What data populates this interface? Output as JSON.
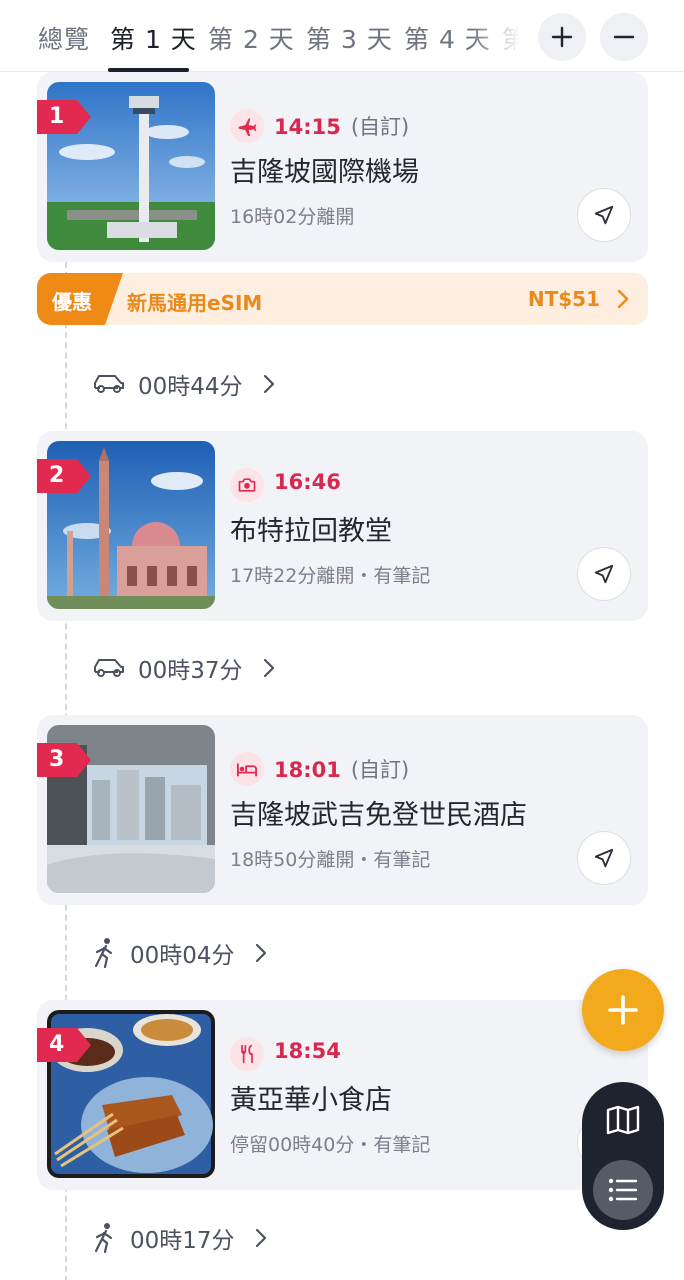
{
  "tabs": {
    "items": [
      {
        "label": "總覽",
        "active": false
      },
      {
        "label": "第 1 天",
        "active": true
      },
      {
        "label": "第 2 天",
        "active": false
      },
      {
        "label": "第 3 天",
        "active": false
      },
      {
        "label": "第 4 天",
        "active": false
      },
      {
        "label": "第",
        "active": false
      }
    ],
    "add_icon": "plus-icon",
    "remove_icon": "minus-icon"
  },
  "colors": {
    "accent_red": "#d8284f",
    "promo_orange": "#ef8a17",
    "fab_yellow": "#f2a91c",
    "dark_panel": "#1f2330"
  },
  "stops": [
    {
      "number": "1",
      "icon": "airplane-icon",
      "time": "14:15",
      "note": "(自訂)",
      "name": "吉隆坡國際機場",
      "sub": "16時02分離開"
    },
    {
      "number": "2",
      "icon": "camera-icon",
      "time": "16:46",
      "note": "",
      "name": "布特拉回教堂",
      "sub": "17時22分離開・有筆記"
    },
    {
      "number": "3",
      "icon": "bed-icon",
      "time": "18:01",
      "note": "(自訂)",
      "name": "吉隆坡武吉免登世民酒店",
      "sub": "18時50分離開・有筆記"
    },
    {
      "number": "4",
      "icon": "fork-knife-icon",
      "time": "18:54",
      "note": "",
      "name": "黃亞華小食店",
      "sub": "停留00時40分・有筆記"
    }
  ],
  "promo": {
    "tag": "優惠",
    "text": "新馬通用eSIM",
    "price": "NT$51"
  },
  "transports": [
    {
      "icon": "car-icon",
      "duration": "00時44分"
    },
    {
      "icon": "car-icon",
      "duration": "00時37分"
    },
    {
      "icon": "walk-icon",
      "duration": "00時04分"
    },
    {
      "icon": "walk-icon",
      "duration": "00時17分"
    }
  ],
  "fab": {
    "add_icon": "plus-icon",
    "map_icon": "map-icon",
    "list_icon": "list-icon"
  }
}
